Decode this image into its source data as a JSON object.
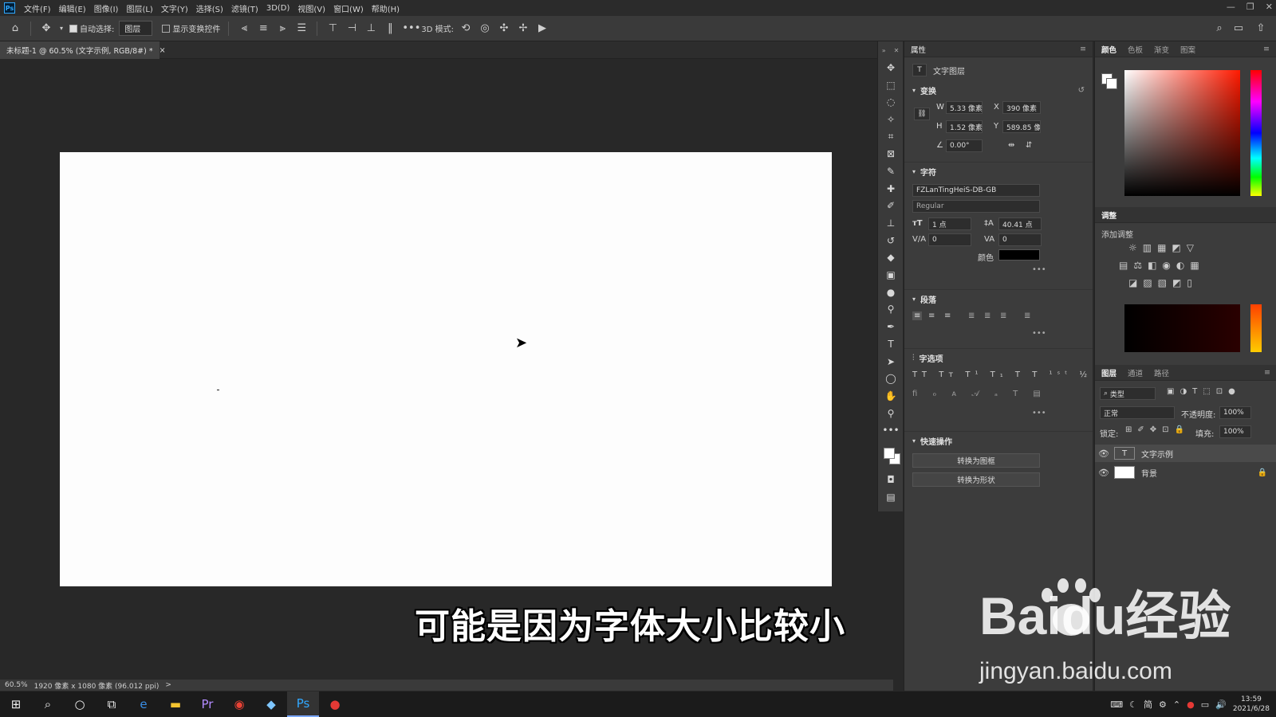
{
  "menubar": {
    "logo": "Ps",
    "items": [
      "文件(F)",
      "编辑(E)",
      "图像(I)",
      "图层(L)",
      "文字(Y)",
      "选择(S)",
      "滤镜(T)",
      "3D(D)",
      "视图(V)",
      "窗口(W)",
      "帮助(H)"
    ]
  },
  "options": {
    "auto_select_label": "自动选择:",
    "auto_select_value": "图层",
    "show_transform_label": "显示变换控件",
    "more": "•••",
    "mode_3d": "3D 模式:"
  },
  "document": {
    "tab_title": "未标题-1 @ 60.5% (文字示例, RGB/8#) *",
    "tab_close": "×",
    "status_zoom": "60.5%",
    "status_info": "1920 像素 x 1080 像素 (96.012 ppi)",
    "status_arrow": ">"
  },
  "properties": {
    "tab": "属性",
    "layer_type": "文字图层",
    "transform": {
      "title": "变换",
      "w_label": "W",
      "w_value": "5.33 像素",
      "h_label": "H",
      "h_value": "1.52 像素",
      "x_label": "X",
      "x_value": "390 像素",
      "y_label": "Y",
      "y_value": "589.85 像素",
      "angle_value": "0.00°"
    },
    "character": {
      "title": "字符",
      "font_family": "FZLanTingHeiS-DB-GB",
      "font_style": "Regular",
      "size": "1 点",
      "leading": "40.41 点",
      "kerning": "0",
      "tracking": "0",
      "color_label": "颜色",
      "color_value": "#000000"
    },
    "paragraph": {
      "title": "段落"
    },
    "options_title": "字选项",
    "quick": {
      "title": "快速操作",
      "btn1": "转换为图框",
      "btn2": "转换为形状"
    },
    "more": "•••"
  },
  "color_panel": {
    "tabs": [
      "颜色",
      "色板",
      "渐变",
      "图案"
    ]
  },
  "adjust_panel": {
    "tab": "调整",
    "add_label": "添加调整"
  },
  "layers_panel": {
    "tabs": [
      "图层",
      "通道",
      "路径"
    ],
    "filter_label": "类型",
    "blend_mode": "正常",
    "opacity_label": "不透明度:",
    "opacity_value": "100%",
    "lock_label": "锁定:",
    "fill_label": "填充:",
    "fill_value": "100%",
    "layers": [
      {
        "name": "文字示例",
        "thumb": "T"
      },
      {
        "name": "背景",
        "thumb": ""
      }
    ]
  },
  "taskbar": {
    "time": "13:59",
    "date": "2021/6/28",
    "ime": "简"
  },
  "overlay": {
    "subtitle": "可能是因为字体大小比较小",
    "watermark_main": "Baidu经验",
    "watermark_url": "jingyan.baidu.com"
  }
}
